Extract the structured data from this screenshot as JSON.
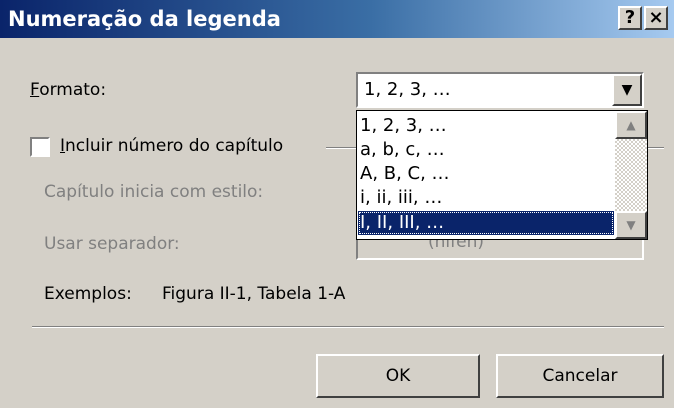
{
  "window": {
    "title": "Numeração da legenda",
    "help_glyph": "?",
    "close_glyph": "×"
  },
  "formato": {
    "label_accel": "F",
    "label_rest": "ormato:",
    "value": "1, 2, 3, …",
    "options": [
      "1, 2, 3, …",
      "a, b, c, …",
      "A, B, C, …",
      "i, ii, iii, …",
      "I, II, III, …"
    ],
    "selected_index": 4
  },
  "capitulo": {
    "checkbox_accel": "I",
    "checkbox_rest": "ncluir número do capítulo",
    "checked": false,
    "estilo_label": "Capítulo inicia com estilo:",
    "separador_label": "Usar separador:",
    "separador_value": "(hífen)"
  },
  "exemplos": {
    "label": "Exemplos:",
    "value": "Figura II-1, Tabela 1-A"
  },
  "buttons": {
    "ok": "OK",
    "cancel": "Cancelar"
  },
  "icons": {
    "dropdown_arrow": "chevron-down-icon",
    "scroll_up": "scroll-up-icon",
    "scroll_down": "scroll-down-icon"
  },
  "colors": {
    "title_bar": "#0a246a",
    "selection": "#0a246a",
    "dialog_face": "#d4d0c8"
  }
}
